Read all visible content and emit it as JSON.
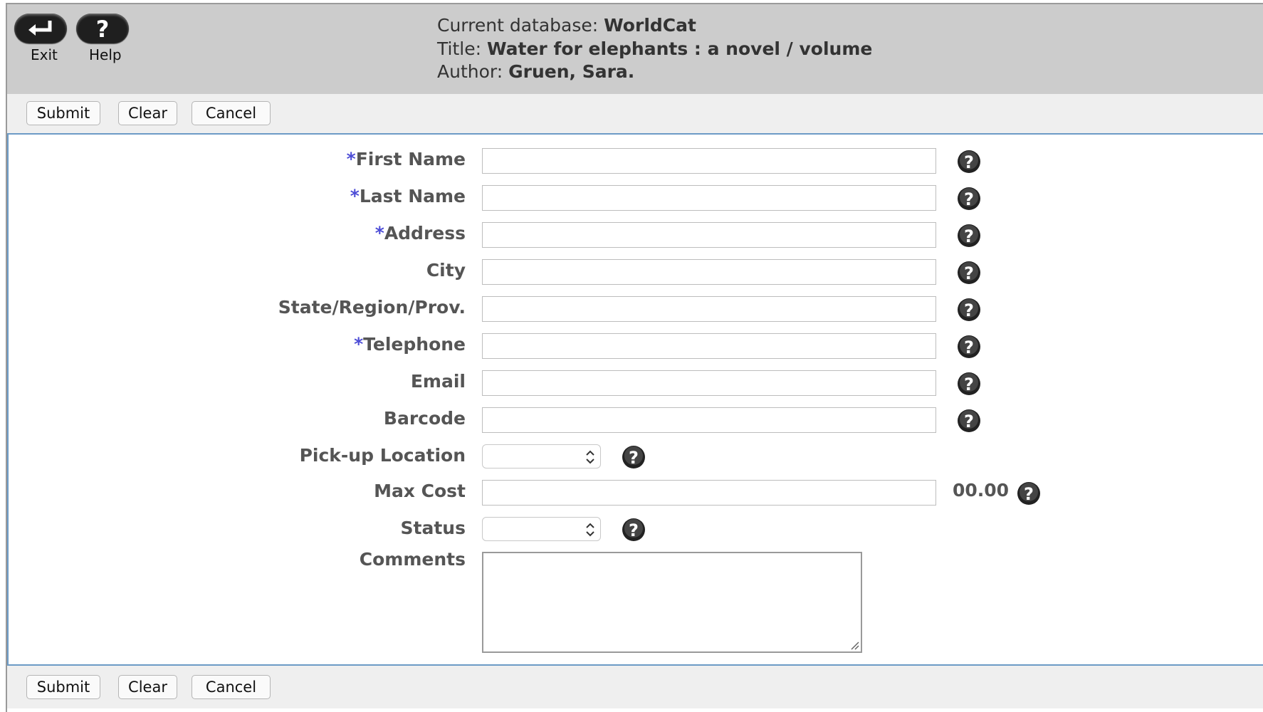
{
  "header": {
    "exit_label": "Exit",
    "help_label": "Help",
    "database_prefix": "Current database: ",
    "database": "WorldCat",
    "title_prefix": "Title: ",
    "title": "Water for elephants : a novel / volume",
    "author_prefix": "Author: ",
    "author": "Gruen, Sara."
  },
  "toolbar": {
    "submit_label": "Submit",
    "clear_label": "Clear",
    "cancel_label": "Cancel"
  },
  "form": {
    "required_marker": "*",
    "first_name": "First Name",
    "last_name": "Last Name",
    "address": "Address",
    "city": "City",
    "state": "State/Region/Prov.",
    "telephone": "Telephone",
    "email": "Email",
    "barcode": "Barcode",
    "pickup": "Pick-up Location",
    "max_cost": "Max Cost",
    "max_cost_suffix": "00.00",
    "status": "Status",
    "comments": "Comments"
  },
  "icons": {
    "exit": "return-arrow-icon",
    "help": "question-mark-icon",
    "field_help": "help-circle-icon",
    "select": "chevron-up-down-icon",
    "resize": "resize-grip-icon"
  }
}
